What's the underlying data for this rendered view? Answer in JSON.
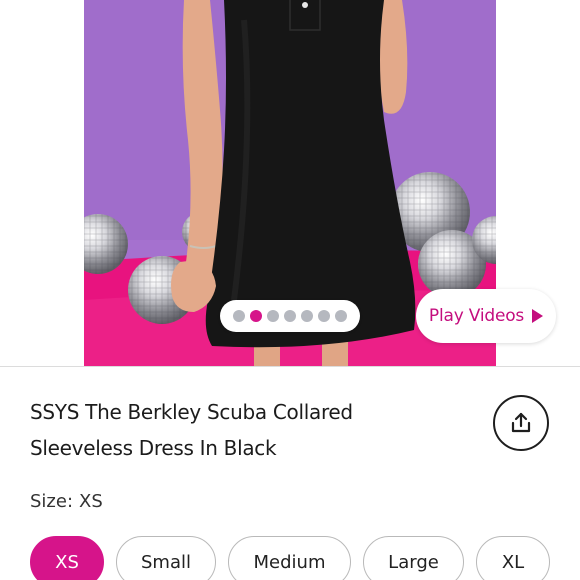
{
  "product": {
    "image_alt": "Model wearing a black sleeveless collared scuba dress in front of a purple wall with pink floor and disco balls",
    "carousel": {
      "total": 7,
      "active_index": 1
    },
    "play_videos_label": "Play Videos",
    "title_line1": "SSYS The Berkley Scuba Collared",
    "title_line2": "Sleeveless Dress In Black",
    "share_icon": "share-icon"
  },
  "size": {
    "label": "Size:",
    "selected_value": "XS",
    "options": [
      "XS",
      "Small",
      "Medium",
      "Large",
      "XL"
    ]
  },
  "colors": {
    "accent": "#d6148a",
    "play_text": "#c40e7e",
    "backdrop_purple": "#a873d0",
    "floor_pink": "#e8137f",
    "dress_black": "#161616"
  }
}
